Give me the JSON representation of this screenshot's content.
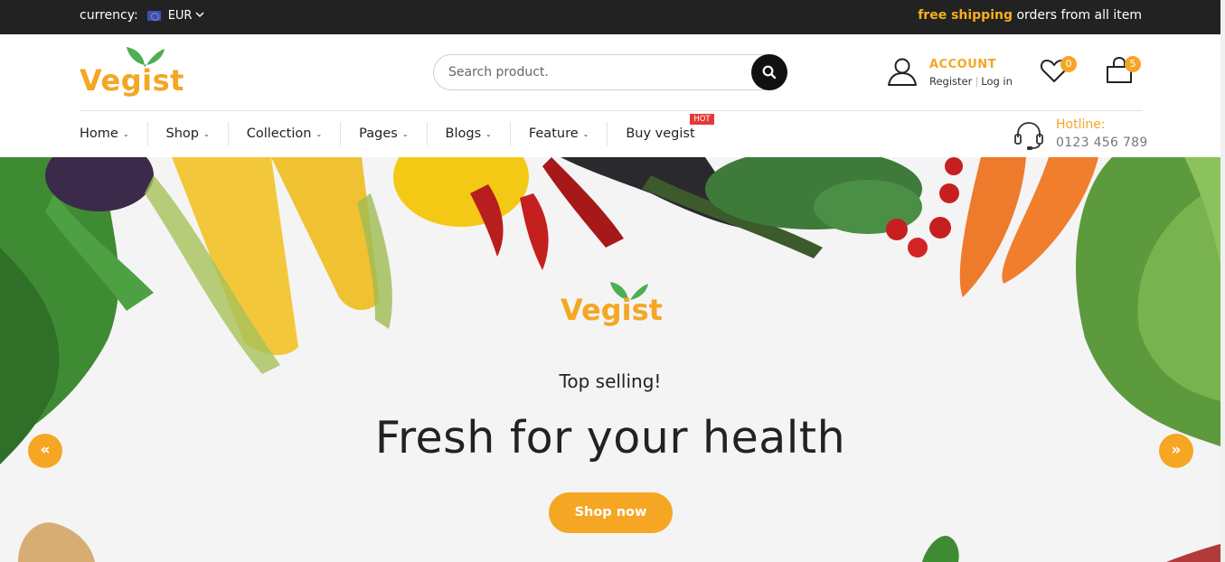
{
  "topbar": {
    "currency_label": "currency:",
    "currency_code": "EUR",
    "shipping_highlight": "free shipping",
    "shipping_rest": " orders from all item"
  },
  "header": {
    "logo_text": "Vegist",
    "search": {
      "placeholder": "Search product."
    },
    "account": {
      "title": "ACCOUNT",
      "register": "Register",
      "login": "Log in"
    },
    "wishlist_count": "0",
    "cart_count": "5"
  },
  "nav": {
    "items": [
      {
        "label": "Home"
      },
      {
        "label": "Shop"
      },
      {
        "label": "Collection"
      },
      {
        "label": "Pages"
      },
      {
        "label": "Blogs"
      },
      {
        "label": "Feature"
      },
      {
        "label": "Buy vegist"
      }
    ],
    "hot_badge": "HOT",
    "hotline": {
      "title": "Hotline:",
      "number": "0123 456 789"
    }
  },
  "hero": {
    "logo_text": "Vegist",
    "kicker": "Top selling!",
    "headline": "Fresh for your health",
    "button": "Shop now",
    "prev_icon": "«",
    "next_icon": "»"
  },
  "colors": {
    "accent": "#f5a623",
    "topbar_bg": "#222222",
    "hot": "#e53935",
    "leaf_green": "#4caf50"
  },
  "icons": {
    "currency_flag": "eu-flag-icon",
    "search": "search-icon",
    "account": "user-icon",
    "wishlist": "heart-icon",
    "cart": "bag-icon",
    "hotline": "headset-icon",
    "prev": "chevrons-left-icon",
    "next": "chevrons-right-icon"
  }
}
